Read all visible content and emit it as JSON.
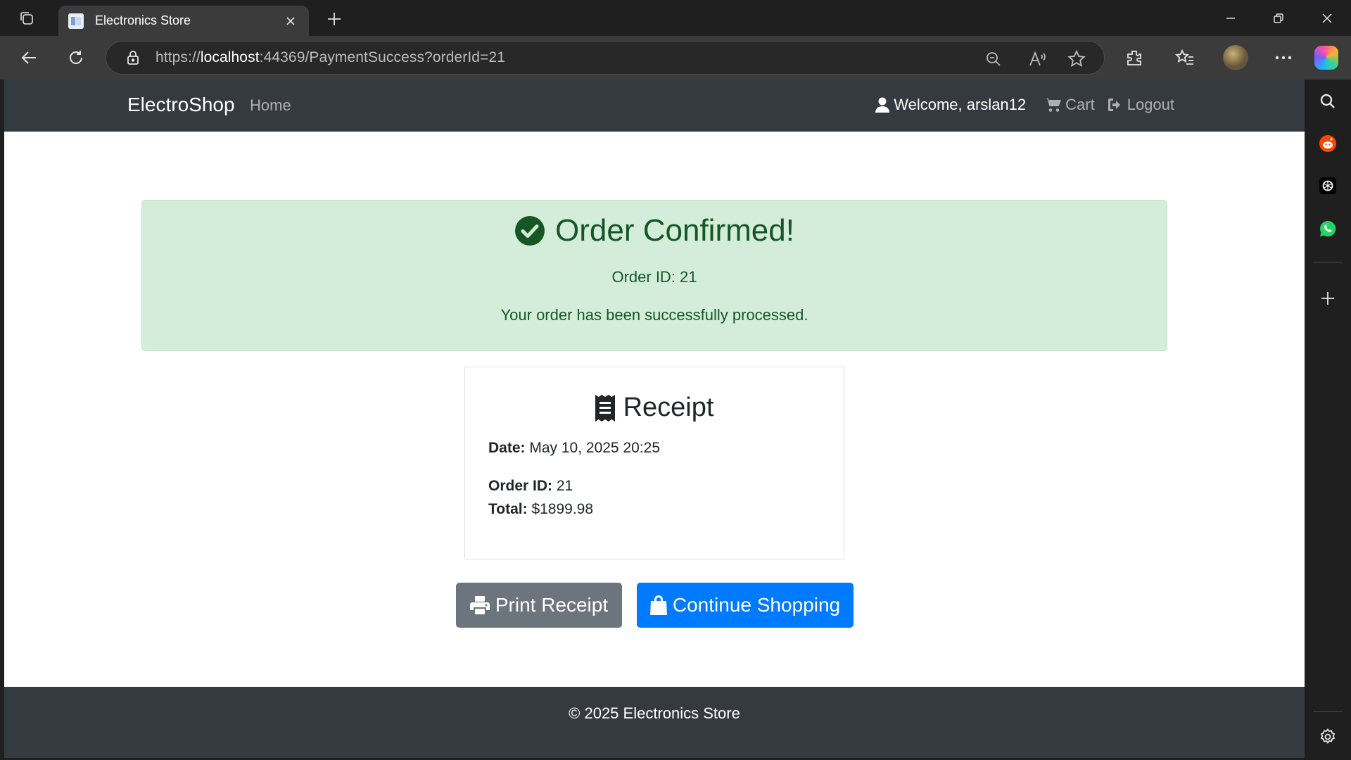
{
  "browser": {
    "tab_title": "Electronics Store",
    "url_prefix": "https://",
    "url_host": "localhost",
    "url_rest": ":44369/PaymentSuccess?orderId=21"
  },
  "navbar": {
    "brand": "ElectroShop",
    "home": "Home",
    "welcome": "Welcome, arslan12",
    "cart": "Cart",
    "logout": "Logout"
  },
  "alert": {
    "heading": "Order Confirmed!",
    "order_id": "Order ID: 21",
    "message": "Your order has been successfully processed."
  },
  "receipt": {
    "title": "Receipt",
    "date_label": "Date:",
    "date_value": "May 10, 2025 20:25",
    "order_label": "Order ID:",
    "order_value": "21",
    "total_label": "Total:",
    "total_value": "$1899.98"
  },
  "buttons": {
    "print": "Print Receipt",
    "continue": "Continue Shopping"
  },
  "footer": {
    "text": "© 2025 Electronics Store"
  },
  "colors": {
    "navbar_bg": "#343a40",
    "alert_bg": "#d4edda",
    "alert_text": "#155724",
    "print_btn": "#6c757d",
    "continue_btn": "#007bff"
  },
  "icons": {
    "sidebar": [
      "search-icon",
      "reddit-icon",
      "chatgpt-icon",
      "whatsapp-icon",
      "add-icon",
      "settings-icon"
    ]
  }
}
